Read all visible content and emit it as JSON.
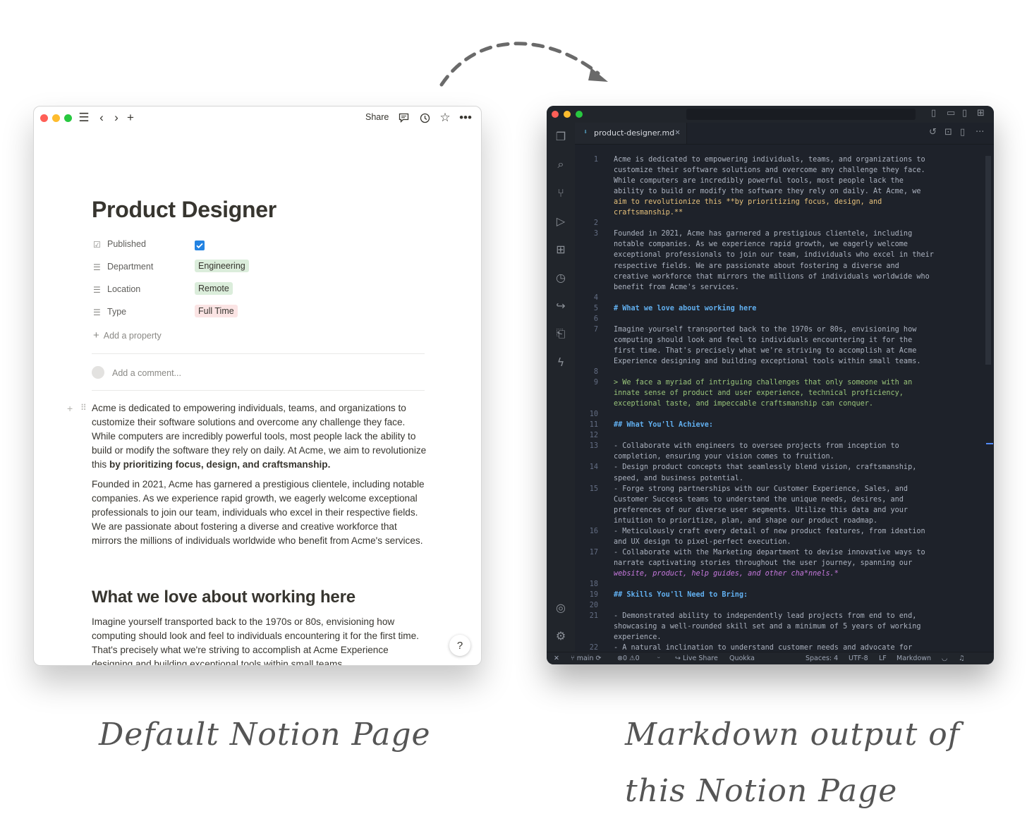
{
  "notion": {
    "share_label": "Share",
    "title": "Product Designer",
    "properties": [
      {
        "label": "Published",
        "icon": "checkbox-icon"
      },
      {
        "label": "Department",
        "value": "Engineering",
        "tag_color": "#dbeddb"
      },
      {
        "label": "Location",
        "value": "Remote",
        "tag_color": "#dbeddb"
      },
      {
        "label": "Type",
        "value": "Full Time",
        "tag_color": "#fbe4e4"
      }
    ],
    "add_property": "Add a property",
    "comment_placeholder": "Add a comment...",
    "para1_a": "Acme is dedicated to empowering individuals, teams, and organizations to customize their software solutions and overcome any challenge they face. While computers are incredibly powerful tools, most people lack the ability to build or modify the software they rely on daily. At Acme, we aim to revolutionize this ",
    "para1_b": "by prioritizing focus, design, and craftsmanship.",
    "para2": "Founded in 2021, Acme has garnered a prestigious clientele, including notable companies. As we experience rapid growth, we eagerly welcome exceptional professionals to join our team, individuals who excel in their respective fields. We are passionate about fostering a diverse and creative workforce that mirrors the millions of individuals worldwide who benefit from Acme's services.",
    "heading": "What we love about working here",
    "para3": "Imagine yourself transported back to the 1970s or 80s, envisioning how computing should look and feel to individuals encountering it for the first time. That's precisely what we're striving to accomplish at Acme Experience designing and building exceptional tools within small teams.",
    "help": "?"
  },
  "vscode": {
    "tab_name": "product-designer.md",
    "code": [
      {
        "n": "1",
        "t": "Acme is dedicated to empowering individuals, teams, and organizations to"
      },
      {
        "n": "",
        "t": "customize their software solutions and overcome any challenge they face."
      },
      {
        "n": "",
        "t": "While computers are incredibly powerful tools, most people lack the"
      },
      {
        "n": "",
        "t": "ability to build or modify the software they rely on daily. At Acme, we"
      },
      {
        "n": "",
        "t": "aim to revolutionize this **by prioritizing focus, design, and",
        "k": "bold"
      },
      {
        "n": "",
        "t": "craftsmanship.**",
        "k": "bold"
      },
      {
        "n": "2",
        "t": ""
      },
      {
        "n": "3",
        "t": "Founded in 2021, Acme has garnered a prestigious clientele, including"
      },
      {
        "n": "",
        "t": "notable companies. As we experience rapid growth, we eagerly welcome"
      },
      {
        "n": "",
        "t": "exceptional professionals to join our team, individuals who excel in their"
      },
      {
        "n": "",
        "t": "respective fields. We are passionate about fostering a diverse and"
      },
      {
        "n": "",
        "t": "creative workforce that mirrors the millions of individuals worldwide who"
      },
      {
        "n": "",
        "t": "benefit from Acme's services."
      },
      {
        "n": "4",
        "t": ""
      },
      {
        "n": "5",
        "t": "# What we love about working here",
        "k": "head"
      },
      {
        "n": "6",
        "t": ""
      },
      {
        "n": "7",
        "t": "Imagine yourself transported back to the 1970s or 80s, envisioning how"
      },
      {
        "n": "",
        "t": "computing should look and feel to individuals encountering it for the"
      },
      {
        "n": "",
        "t": "first time. That's precisely what we're striving to accomplish at Acme"
      },
      {
        "n": "",
        "t": "Experience designing and building exceptional tools within small teams."
      },
      {
        "n": "8",
        "t": ""
      },
      {
        "n": "9",
        "t": "> We face a myriad of intriguing challenges that only someone with an",
        "k": "quote"
      },
      {
        "n": "",
        "t": "innate sense of product and user experience, technical proficiency,",
        "k": "quote"
      },
      {
        "n": "",
        "t": "exceptional taste, and impeccable craftsmanship can conquer.",
        "k": "quote"
      },
      {
        "n": "10",
        "t": ""
      },
      {
        "n": "11",
        "t": "## What You'll Achieve:",
        "k": "head"
      },
      {
        "n": "12",
        "t": ""
      },
      {
        "n": "13",
        "t": "- Collaborate with engineers to oversee projects from inception to",
        "k": "list"
      },
      {
        "n": "",
        "t": "completion, ensuring your vision comes to fruition."
      },
      {
        "n": "14",
        "t": "- Design product concepts that seamlessly blend vision, craftsmanship,",
        "k": "list"
      },
      {
        "n": "",
        "t": "speed, and business potential."
      },
      {
        "n": "15",
        "t": "- Forge strong partnerships with our Customer Experience, Sales, and",
        "k": "list"
      },
      {
        "n": "",
        "t": "Customer Success teams to understand the unique needs, desires, and"
      },
      {
        "n": "",
        "t": "preferences of our diverse user segments. Utilize this data and your"
      },
      {
        "n": "",
        "t": "intuition to prioritize, plan, and shape our product roadmap."
      },
      {
        "n": "16",
        "t": "- Meticulously craft every detail of new product features, from ideation",
        "k": "list"
      },
      {
        "n": "",
        "t": "and UX design to pixel-perfect execution."
      },
      {
        "n": "17",
        "t": "- Collaborate with the Marketing department to devise innovative ways to",
        "k": "list"
      },
      {
        "n": "",
        "t": "narrate captivating stories throughout the user journey, spanning our"
      },
      {
        "n": "",
        "t": "website, product, help guides, and other cha*nnels.*",
        "k": "em"
      },
      {
        "n": "18",
        "t": ""
      },
      {
        "n": "19",
        "t": "## Skills You'll Need to Bring:",
        "k": "head"
      },
      {
        "n": "20",
        "t": ""
      },
      {
        "n": "21",
        "t": "- Demonstrated ability to independently lead projects from end to end,",
        "k": "list"
      },
      {
        "n": "",
        "t": "showcasing a well-rounded skill set and a minimum of 5 years of working"
      },
      {
        "n": "",
        "t": "experience."
      },
      {
        "n": "22",
        "t": "- A natural inclination to understand customer needs and advocate for",
        "k": "list"
      }
    ],
    "status": {
      "branch": "main",
      "errors": "0",
      "warnings": "0",
      "live_share": "Live Share",
      "quokka": "Quokka",
      "spaces": "Spaces: 4",
      "encoding": "UTF-8",
      "eol": "LF",
      "language": "Markdown"
    }
  },
  "captions": {
    "left": "Default Notion Page",
    "right_line1": "Markdown output of",
    "right_line2": "this Notion Page"
  }
}
